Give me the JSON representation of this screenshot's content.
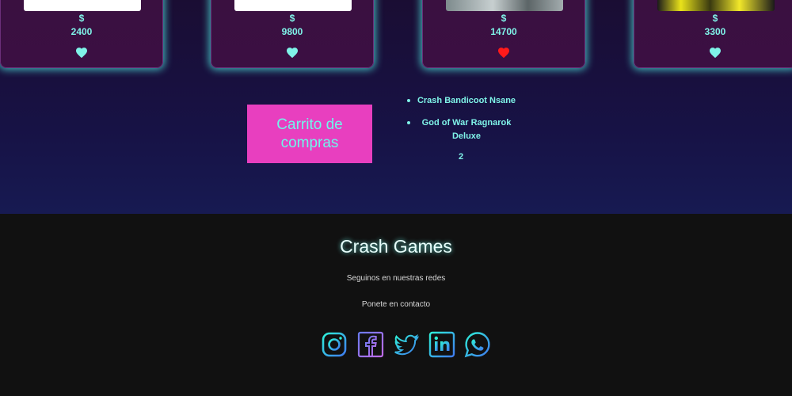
{
  "products": [
    {
      "currency": "$",
      "price": "2400",
      "favorite": false
    },
    {
      "currency": "$",
      "price": "9800",
      "favorite": false
    },
    {
      "currency": "$",
      "price": "14700",
      "favorite": true
    },
    {
      "currency": "$",
      "price": "3300",
      "favorite": false
    }
  ],
  "cart": {
    "button_label": "Carrito de compras",
    "items": [
      "Crash Bandicoot Nsane",
      "God of War Ragnarok Deluxe"
    ],
    "count": "2"
  },
  "footer": {
    "brand": "Crash Games",
    "follow_text": "Seguinos en nuestras redes",
    "contact_text": "Ponete en contacto",
    "socials": [
      "instagram-icon",
      "facebook-icon",
      "twitter-icon",
      "linkedin-icon",
      "whatsapp-icon"
    ]
  },
  "colors": {
    "accent_cyan": "#7ff3e8",
    "cart_button": "#e83fbf",
    "heart_favorite": "#ff1a1a",
    "footer_bg": "#111111"
  }
}
